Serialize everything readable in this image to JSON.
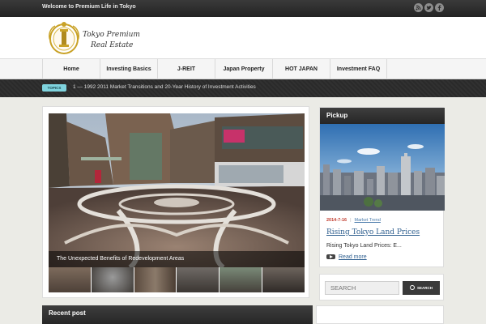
{
  "topbar": {
    "welcome": "Welcome to Premium Life in Tokyo",
    "social_icons": [
      "rss-icon",
      "twitter-icon",
      "facebook-icon"
    ]
  },
  "logo": {
    "line1": "Tokyo Premium",
    "line2": "Real Estate",
    "icon": "gold-emblem-icon"
  },
  "nav": {
    "items": [
      {
        "label": "Home"
      },
      {
        "label": "Investing Basics"
      },
      {
        "label": "J-REIT"
      },
      {
        "label": "Japan Property"
      },
      {
        "label": "HOT JAPAN"
      },
      {
        "label": "Investment FAQ"
      }
    ]
  },
  "topics": {
    "badge": "TOPICS",
    "text": "1 — 1992 2011 Market Transitions and 20-Year History of Investment Activities"
  },
  "slider": {
    "caption": "The Unexpected Benefits of Redevelopment Areas",
    "thumbnail_count": 6
  },
  "recent": {
    "title": "Recent post"
  },
  "pickup": {
    "title": "Pickup",
    "date": "2014-7-16",
    "category": "Market Trend",
    "post_title": "Rising Tokyo Land Prices",
    "excerpt": "Rising Tokyo Land Prices: E...",
    "read_more": "Read more"
  },
  "search": {
    "placeholder": "SEARCH",
    "button_label": "SEARCH"
  },
  "colors": {
    "dark_bar": "#2a2a2a",
    "topics_badge": "#7fd3de",
    "date_red": "#c0392b",
    "link_blue": "#2f5f8f",
    "logo_gold": "#c9a227"
  }
}
